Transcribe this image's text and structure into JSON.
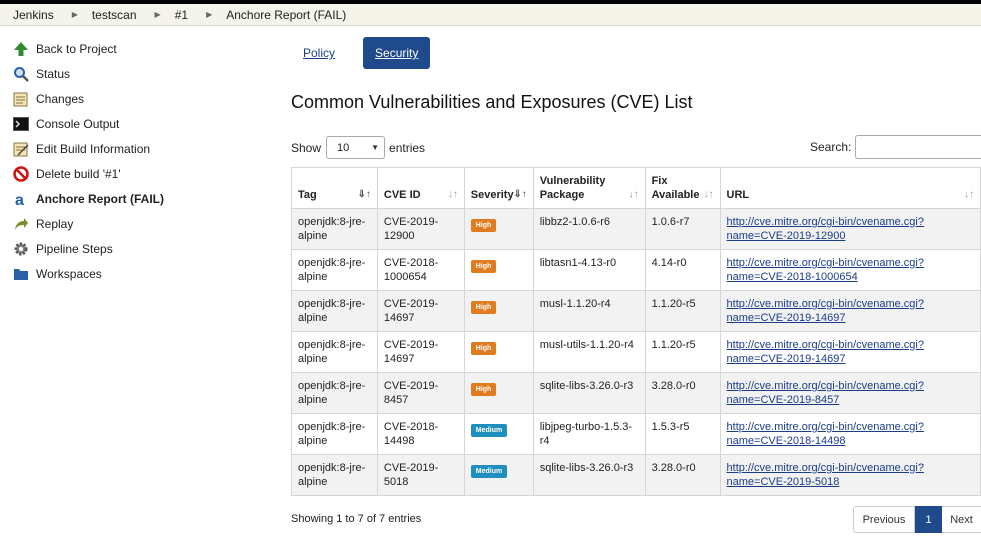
{
  "breadcrumb": [
    "Jenkins",
    "testscan",
    "#1",
    "Anchore Report (FAIL)"
  ],
  "sidebar": {
    "items": [
      {
        "label": "Back to Project",
        "icon": "up-arrow-icon"
      },
      {
        "label": "Status",
        "icon": "magnifier-icon"
      },
      {
        "label": "Changes",
        "icon": "notepad-icon"
      },
      {
        "label": "Console Output",
        "icon": "terminal-icon"
      },
      {
        "label": "Edit Build Information",
        "icon": "notepad-edit-icon"
      },
      {
        "label": "Delete build '#1'",
        "icon": "no-entry-icon"
      },
      {
        "label": "Anchore Report (FAIL)",
        "icon": "anchore-icon"
      },
      {
        "label": "Replay",
        "icon": "replay-arrow-icon"
      },
      {
        "label": "Pipeline Steps",
        "icon": "gear-icon"
      },
      {
        "label": "Workspaces",
        "icon": "folder-icon"
      }
    ]
  },
  "tabs": {
    "policy": "Policy",
    "security": "Security"
  },
  "title": "Common Vulnerabilities and Exposures (CVE) List",
  "controls": {
    "show_label": "Show",
    "entries_value": "10",
    "entries_label": "entries",
    "search_label": "Search:",
    "search_value": ""
  },
  "table": {
    "headers": [
      "Tag",
      "CVE ID",
      "Severity",
      "Vulnerability Package",
      "Fix Available",
      "URL"
    ],
    "rows": [
      {
        "tag": "openjdk:8-jre-alpine",
        "cve": "CVE-2019-12900",
        "severity": "High",
        "package": "libbz2-1.0.6-r6",
        "fix": "1.0.6-r7",
        "url": "http://cve.mitre.org/cgi-bin/cvename.cgi?name=CVE-2019-12900"
      },
      {
        "tag": "openjdk:8-jre-alpine",
        "cve": "CVE-2018-1000654",
        "severity": "High",
        "package": "libtasn1-4.13-r0",
        "fix": "4.14-r0",
        "url": "http://cve.mitre.org/cgi-bin/cvename.cgi?name=CVE-2018-1000654"
      },
      {
        "tag": "openjdk:8-jre-alpine",
        "cve": "CVE-2019-14697",
        "severity": "High",
        "package": "musl-1.1.20-r4",
        "fix": "1.1.20-r5",
        "url": "http://cve.mitre.org/cgi-bin/cvename.cgi?name=CVE-2019-14697"
      },
      {
        "tag": "openjdk:8-jre-alpine",
        "cve": "CVE-2019-14697",
        "severity": "High",
        "package": "musl-utils-1.1.20-r4",
        "fix": "1.1.20-r5",
        "url": "http://cve.mitre.org/cgi-bin/cvename.cgi?name=CVE-2019-14697"
      },
      {
        "tag": "openjdk:8-jre-alpine",
        "cve": "CVE-2019-8457",
        "severity": "High",
        "package": "sqlite-libs-3.26.0-r3",
        "fix": "3.28.0-r0",
        "url": "http://cve.mitre.org/cgi-bin/cvename.cgi?name=CVE-2019-8457"
      },
      {
        "tag": "openjdk:8-jre-alpine",
        "cve": "CVE-2018-14498",
        "severity": "Medium",
        "package": "libjpeg-turbo-1.5.3-r4",
        "fix": "1.5.3-r5",
        "url": "http://cve.mitre.org/cgi-bin/cvename.cgi?name=CVE-2018-14498"
      },
      {
        "tag": "openjdk:8-jre-alpine",
        "cve": "CVE-2019-5018",
        "severity": "Medium",
        "package": "sqlite-libs-3.26.0-r3",
        "fix": "3.28.0-r0",
        "url": "http://cve.mitre.org/cgi-bin/cvename.cgi?name=CVE-2019-5018"
      }
    ]
  },
  "severity_colors": {
    "High": "#e07b1f",
    "Medium": "#1f8fbf"
  },
  "footer": {
    "info": "Showing 1 to 7 of 7 entries",
    "previous": "Previous",
    "page": "1",
    "next": "Next"
  }
}
